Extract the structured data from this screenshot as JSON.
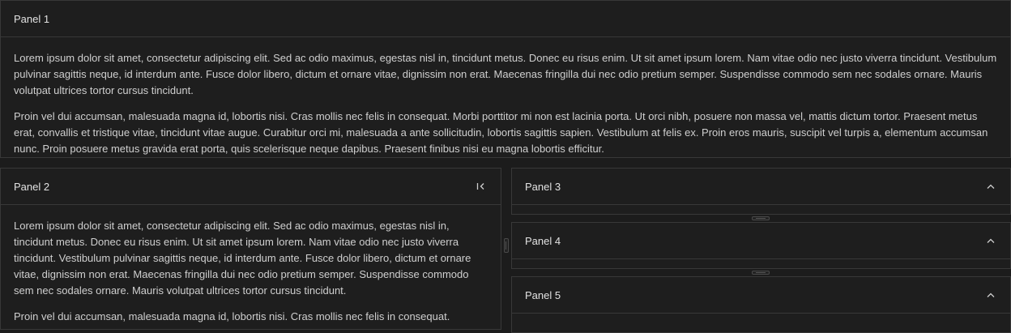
{
  "panels": {
    "panel1": {
      "title": "Panel 1",
      "paragraphs": [
        "Lorem ipsum dolor sit amet, consectetur adipiscing elit. Sed ac odio maximus, egestas nisl in, tincidunt metus. Donec eu risus enim. Ut sit amet ipsum lorem. Nam vitae odio nec justo viverra tincidunt. Vestibulum pulvinar sagittis neque, id interdum ante. Fusce dolor libero, dictum et ornare vitae, dignissim non erat. Maecenas fringilla dui nec odio pretium semper. Suspendisse commodo sem nec sodales ornare. Mauris volutpat ultrices tortor cursus tincidunt.",
        "Proin vel dui accumsan, malesuada magna id, lobortis nisi. Cras mollis nec felis in consequat. Morbi porttitor mi non est lacinia porta. Ut orci nibh, posuere non massa vel, mattis dictum tortor. Praesent metus erat, convallis et tristique vitae, tincidunt vitae augue. Curabitur orci mi, malesuada a ante sollicitudin, lobortis sagittis sapien. Vestibulum at felis ex. Proin eros mauris, suscipit vel turpis a, elementum accumsan nunc. Proin posuere metus gravida erat porta, quis scelerisque neque dapibus. Praesent finibus nisi eu magna lobortis efficitur."
      ]
    },
    "panel2": {
      "title": "Panel 2",
      "header_icon": "collapse-left-icon",
      "paragraphs": [
        "Lorem ipsum dolor sit amet, consectetur adipiscing elit. Sed ac odio maximus, egestas nisl in, tincidunt metus. Donec eu risus enim. Ut sit amet ipsum lorem. Nam vitae odio nec justo viverra tincidunt. Vestibulum pulvinar sagittis neque, id interdum ante. Fusce dolor libero, dictum et ornare vitae, dignissim non erat. Maecenas fringilla dui nec odio pretium semper. Suspendisse commodo sem nec sodales ornare. Mauris volutpat ultrices tortor cursus tincidunt.",
        "Proin vel dui accumsan, malesuada magna id, lobortis nisi. Cras mollis nec felis in consequat."
      ]
    },
    "panel3": {
      "title": "Panel 3",
      "header_icon": "chevron-up-icon"
    },
    "panel4": {
      "title": "Panel 4",
      "header_icon": "chevron-up-icon"
    },
    "panel5": {
      "title": "Panel 5",
      "header_icon": "chevron-up-icon"
    }
  },
  "theme": {
    "background": "#1c1c1c",
    "panel": "#1e1e1e",
    "border": "#383838",
    "text": "#cfcfcf"
  }
}
